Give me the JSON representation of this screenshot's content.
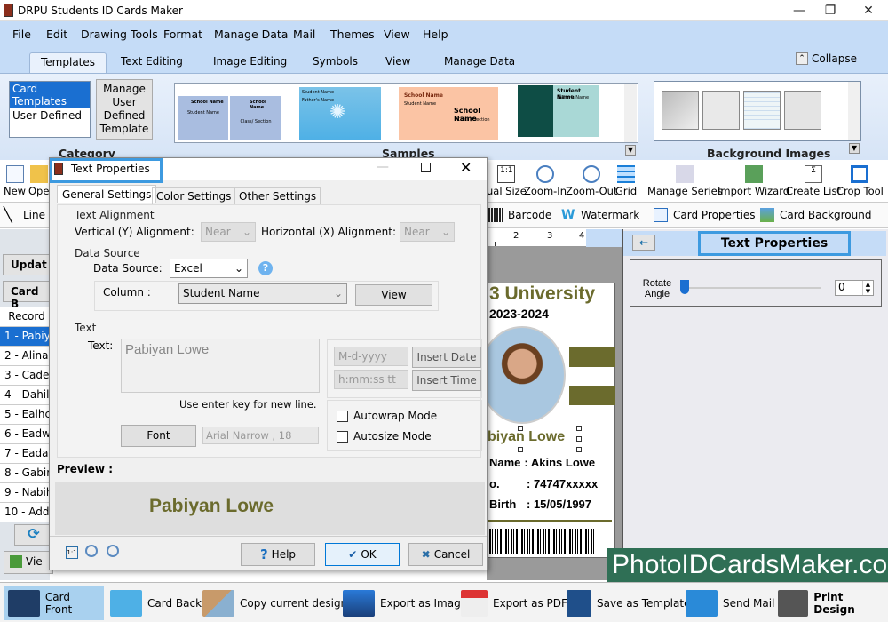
{
  "window": {
    "title": "DRPU Students ID Cards Maker",
    "minimize": "—",
    "restore": "❐",
    "close": "✕"
  },
  "menu": [
    "File",
    "Edit",
    "Drawing Tools",
    "Format",
    "Manage Data",
    "Mail",
    "Themes",
    "View",
    "Help"
  ],
  "ribbon_tabs": [
    "Templates",
    "Text Editing",
    "Image Editing",
    "Symbols",
    "View",
    "Manage Data"
  ],
  "ribbon_active_tab": "Templates",
  "collapse_label": "Collapse",
  "ribbon": {
    "category": {
      "label": "Category",
      "items": [
        "Card Templates",
        "User Defined"
      ],
      "selected": "Card Templates",
      "manage_button": "Manage User Defined Template"
    },
    "samples": {
      "label": "Samples",
      "thumbs": [
        {
          "school": "School Name",
          "line": "Student Name"
        },
        {
          "school": "School Name",
          "line": "Class/ Section"
        },
        {
          "school": "Student Name",
          "line": "Father's Name"
        },
        {
          "school": "School Name",
          "line": "Student Name"
        },
        {
          "school": "School Name",
          "line": "Class / Section"
        },
        {
          "school": "Student Name",
          "line": "Father's Name"
        }
      ]
    },
    "background_images": {
      "label": "Background Images"
    }
  },
  "toolbar1": {
    "left": [
      "New",
      "Ope"
    ],
    "right": [
      "ual Size",
      "Zoom-In",
      "Zoom-Out",
      "Grid",
      "Manage Series",
      "Import Wizard",
      "Create List",
      "Crop Tool"
    ]
  },
  "toolbar2": {
    "left": [
      "Line"
    ],
    "right": [
      "Barcode",
      "Watermark",
      "Card Properties",
      "Card Background"
    ]
  },
  "left_panel": {
    "update_button": "Updat",
    "card_button": "Card B",
    "record_header": "Record",
    "records": [
      "1 - Pabiy",
      "2 - Alina",
      "3 - Cade",
      "4 - Dahil",
      "5 - Ealhc",
      "6 - Eadw",
      "7 - Eada",
      "8 - Gabir",
      "9 - Nabih",
      "10 - Add"
    ],
    "selected_record": 0,
    "view_button": "Vie"
  },
  "ruler": {
    "ticks": [
      "2",
      "3",
      "4"
    ]
  },
  "card": {
    "university": "3 University",
    "year": "2023-2024",
    "student_name": "biyan Lowe",
    "fields": [
      {
        "label": "Name",
        "value": ": Akins  Lowe"
      },
      {
        "label": "o.",
        "value": ": 74747xxxxx"
      },
      {
        "label": "Birth",
        "value": ": 15/05/1997"
      }
    ],
    "accent": "#6b6b2d"
  },
  "right_panel": {
    "title": "Text Properties",
    "back": "←",
    "rotate_label": "Rotate Angle",
    "rotate_value": "0",
    "rotate_fraction": 0
  },
  "dialog": {
    "title": "Text Properties",
    "tabs": [
      "General Settings",
      "Color Settings",
      "Other Settings"
    ],
    "active_tab": "General Settings",
    "text_alignment": {
      "legend": "Text Alignment",
      "vertical_label": "Vertical (Y) Alignment:",
      "vertical_value": "Near",
      "horizontal_label": "Horizontal (X) Alignment:",
      "horizontal_value": "Near"
    },
    "data_source": {
      "legend": "Data Source",
      "label": "Data Source:",
      "value": "Excel",
      "help": "?",
      "column_label": "Column :",
      "column_value": "Student Name",
      "view_button": "View"
    },
    "text": {
      "legend": "Text",
      "label": "Text:",
      "value": "Pabiyan Lowe",
      "hint": "Use enter key for new line.",
      "font_button": "Font",
      "font_value": "Arial Narrow , 18",
      "date_format": "M-d-yyyy",
      "insert_date": "Insert Date",
      "time_format": "h:mm:ss tt",
      "insert_time": "Insert Time",
      "autowrap": "Autowrap Mode",
      "autowrap_checked": false,
      "autosize": "Autosize Mode",
      "autosize_checked": false
    },
    "preview_label": "Preview :",
    "preview_text": "Pabiyan Lowe",
    "preview_color": "#6b6b2d",
    "zoom_actual": "1:1",
    "help_button": "Help",
    "ok_button": "OK",
    "cancel_button": "Cancel"
  },
  "bottom_bar": [
    "Card Front",
    "Card Back",
    "Copy current design",
    "Export as Image",
    "Export as PDF",
    "Save as Template",
    "Send Mail",
    "Print Design"
  ],
  "bottom_active": "Card Front",
  "watermark": "PhotoIDCardsMaker.com"
}
